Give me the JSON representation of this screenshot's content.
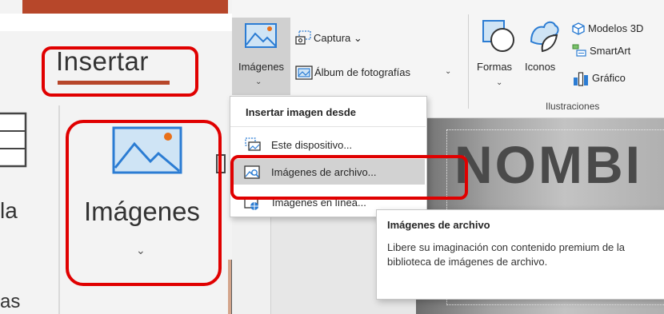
{
  "zoom_panel": {
    "tab_label": "Insertar",
    "button_label": "Imágenes",
    "left_fragment_1": "la",
    "left_fragment_2": "as"
  },
  "ribbon": {
    "imagenes_label": "Imágenes",
    "captura_label": "Captura",
    "album_label": "Álbum de fotografías",
    "formas_label": "Formas",
    "iconos_label": "Iconos",
    "modelos_label": "Modelos 3D",
    "smartart_label": "SmartArt",
    "grafico_label": "Gráfico",
    "group_label": "Ilustraciones"
  },
  "dropdown": {
    "title": "Insertar imagen desde",
    "items": [
      {
        "label": "Este dispositivo...",
        "icon": "device-folder-icon",
        "selected": false
      },
      {
        "label": "Imágenes de archivo...",
        "icon": "stock-images-icon",
        "selected": true
      },
      {
        "label": "Imágenes en línea...",
        "icon": "online-images-icon",
        "selected": false
      }
    ]
  },
  "tooltip": {
    "title": "Imágenes de archivo",
    "body": "Libere su imaginación con contenido premium de la biblioteca de imágenes de archivo."
  },
  "slide": {
    "title_fragment": "NOMBI"
  },
  "colors": {
    "accent": "#b7472a",
    "highlight": "#e00000",
    "icon_blue": "#2b7cd3",
    "icon_light_blue": "#cfe4f5",
    "icon_orange": "#e8701a"
  }
}
